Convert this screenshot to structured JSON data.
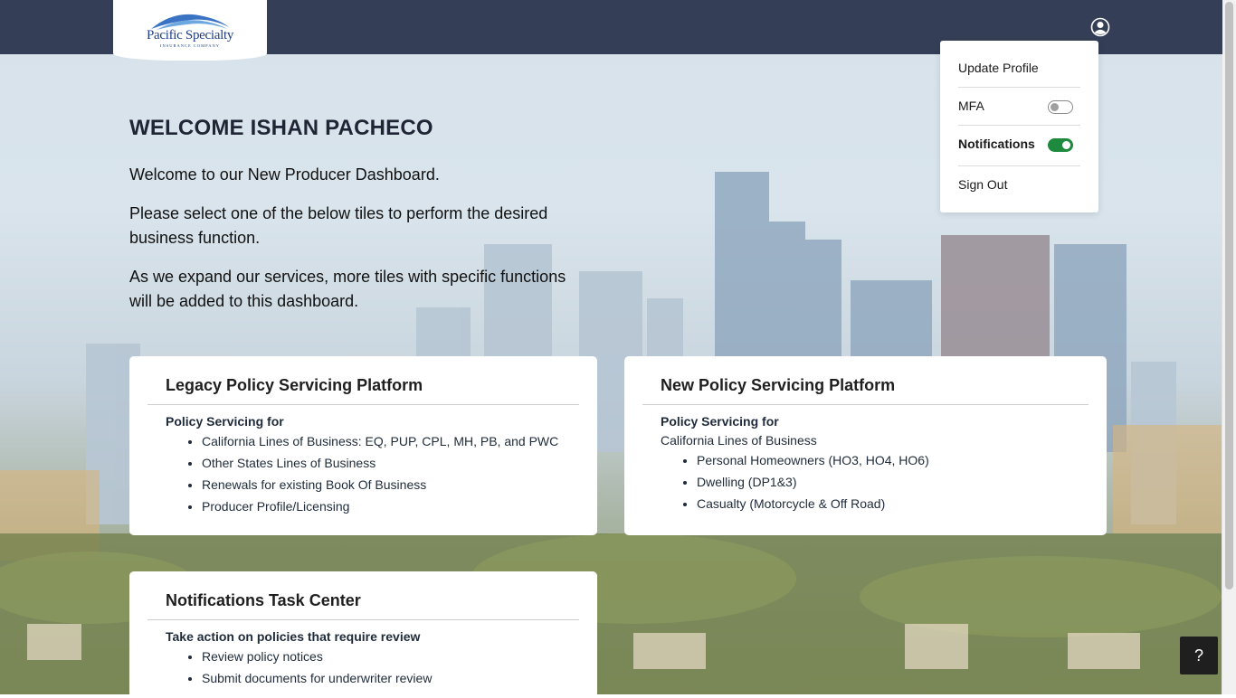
{
  "logo": {
    "name": "Pacific Specialty",
    "tagline": "INSURANCE COMPANY"
  },
  "user_menu": {
    "update_profile": "Update Profile",
    "mfa_label": "MFA",
    "mfa_enabled": false,
    "notifications_label": "Notifications",
    "notifications_enabled": true,
    "sign_out": "Sign Out"
  },
  "welcome": {
    "title": "WELCOME ISHAN PACHECO",
    "line1": "Welcome to our New Producer Dashboard.",
    "line2": "Please select one of the below tiles to perform the desired business function.",
    "line3": "As we expand our services, more tiles with specific functions will be added to this dashboard."
  },
  "cards": {
    "legacy": {
      "title": "Legacy Policy Servicing Platform",
      "subtitle": "Policy Servicing for",
      "items": [
        "California Lines of Business: EQ, PUP, CPL, MH, PB, and PWC",
        "Other States Lines of Business",
        "Renewals for existing Book Of Business",
        "Producer Profile/Licensing"
      ]
    },
    "new": {
      "title": "New Policy Servicing Platform",
      "subtitle": "Policy Servicing for",
      "line": "California Lines of Business",
      "items": [
        "Personal Homeowners (HO3, HO4, HO6)",
        "Dwelling (DP1&3)",
        "Casualty (Motorcycle & Off Road)"
      ]
    },
    "notifications": {
      "title": "Notifications Task Center",
      "subtitle": "Take action on policies that require review",
      "items": [
        "Review policy notices",
        "Submit documents for underwriter review"
      ]
    }
  },
  "help_button": "?",
  "colors": {
    "header": "#343f57",
    "toggle_on": "#1e8a3e"
  }
}
